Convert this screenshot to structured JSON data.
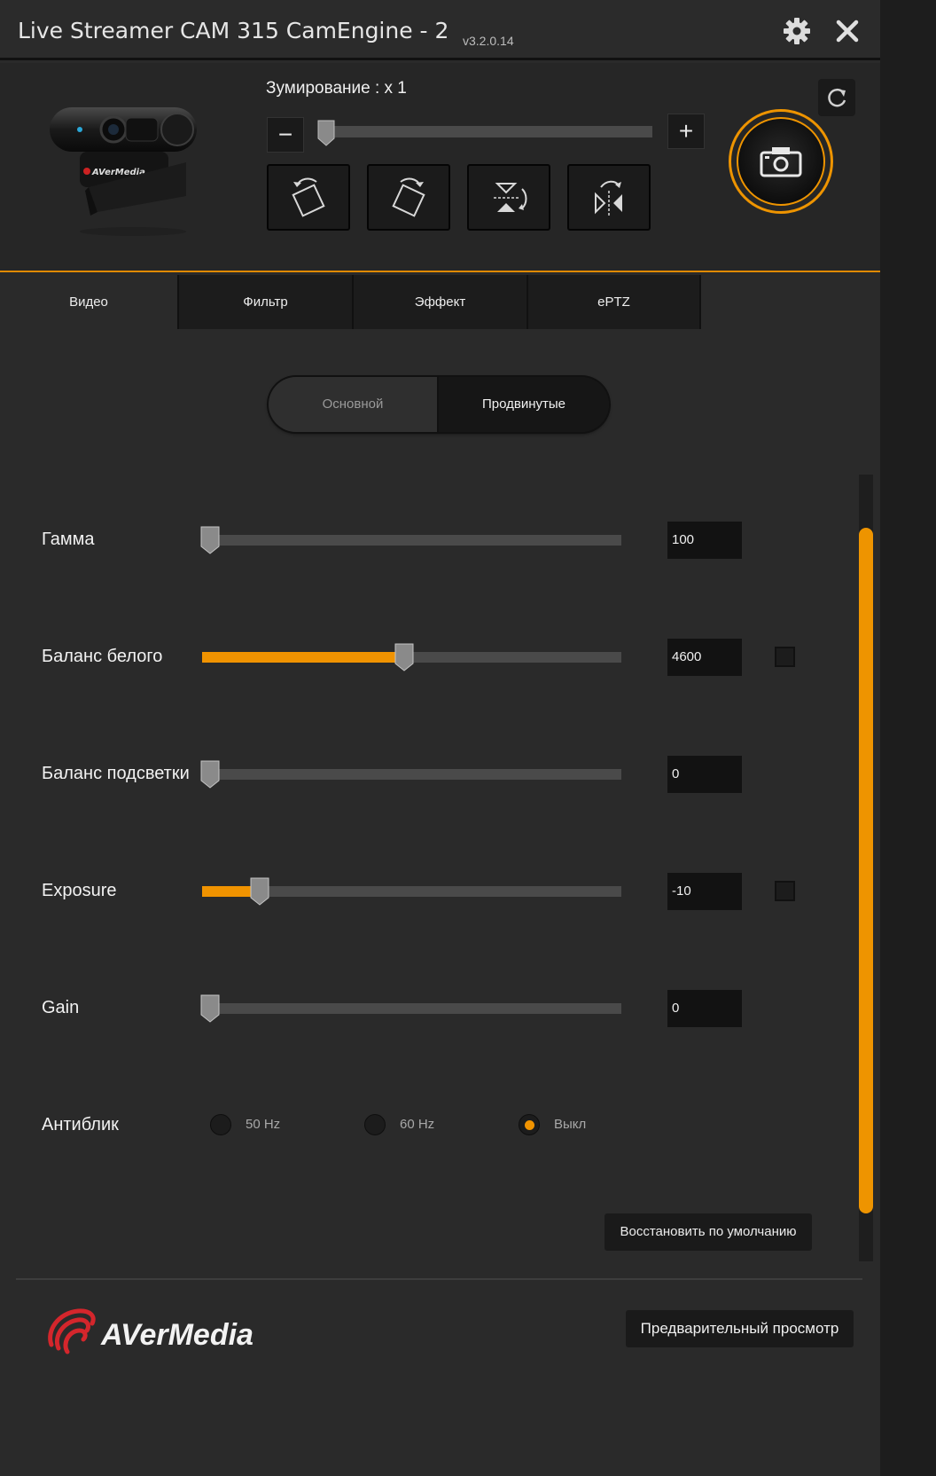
{
  "window": {
    "title": "Live Streamer CAM 315 CamEngine - 2",
    "version": "v3.2.0.14",
    "icons": {
      "settings": "gear-icon",
      "close": "close-icon",
      "refresh": "refresh-icon",
      "snapshot": "camera-icon"
    }
  },
  "zoom": {
    "label": "Зумирование : x 1",
    "minus_label": "−",
    "plus_label": "+",
    "value_fraction": 0
  },
  "transform_buttons": [
    {
      "name": "rotate-left-icon"
    },
    {
      "name": "rotate-right-icon"
    },
    {
      "name": "flip-vertical-icon"
    },
    {
      "name": "mirror-horizontal-icon"
    }
  ],
  "tabs": [
    {
      "label": "Видео",
      "active": true
    },
    {
      "label": "Фильтр",
      "active": false
    },
    {
      "label": "Эффект",
      "active": false
    },
    {
      "label": "ePTZ",
      "active": false
    }
  ],
  "mode": {
    "basic_label": "Основной",
    "advanced_label": "Продвинутые",
    "selected": "advanced"
  },
  "settings": [
    {
      "label": "Гамма",
      "value": "100",
      "fraction": 0.0,
      "auto_checkbox": false,
      "filled": false
    },
    {
      "label": "Баланс белого",
      "value": "4600",
      "fraction": 0.485,
      "auto_checkbox": true,
      "filled": true
    },
    {
      "label": "Баланс подсветки",
      "value": "0",
      "fraction": 0.0,
      "auto_checkbox": false,
      "filled": false
    },
    {
      "label": "Exposure",
      "value": "-10",
      "fraction": 0.125,
      "auto_checkbox": true,
      "filled": true
    },
    {
      "label": "Gain",
      "value": "0",
      "fraction": 0.0,
      "auto_checkbox": false,
      "filled": false
    }
  ],
  "antiflicker": {
    "label": "Антиблик",
    "options": [
      {
        "label": "50 Hz",
        "selected": false
      },
      {
        "label": "60 Hz",
        "selected": false
      },
      {
        "label": "Выкл",
        "selected": true
      }
    ]
  },
  "restore_label": "Восстановить по умолчанию",
  "preview_label": "Предварительный просмотр",
  "brand": "AVerMedia",
  "colors": {
    "accent": "#f09300",
    "background": "#2a2a2a"
  }
}
